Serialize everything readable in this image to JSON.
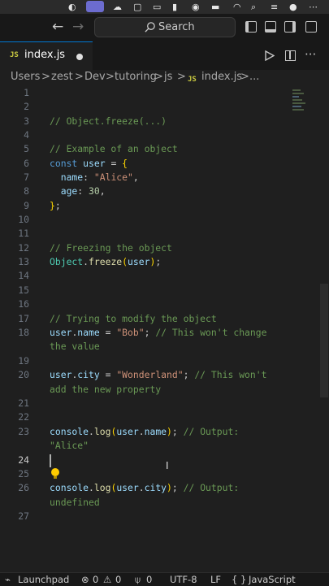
{
  "titlebar": {
    "search_label": "Search"
  },
  "tab": {
    "badge": "JS",
    "filename": "index.js"
  },
  "breadcrumb": {
    "items": [
      "Users",
      "zest",
      "Dev",
      "tutoring",
      "js",
      "index.js",
      "..."
    ],
    "separator": ">",
    "js_badge": "JS"
  },
  "editor": {
    "line_numbers": [
      "1",
      "2",
      "3",
      "4",
      "5",
      "6",
      "7",
      "8",
      "9",
      "10",
      "11",
      "12",
      "13",
      "14",
      "15",
      "16",
      "17",
      "18",
      "19",
      "20",
      "21",
      "22",
      "23",
      "24",
      "25",
      "26",
      "27"
    ],
    "active_line": "24",
    "code": {
      "l3": "// Object.freeze(...)",
      "l5": "// Example of an object",
      "l6_kw": "const",
      "l6_var": "user",
      "l6_op": " = ",
      "l6_br": "{",
      "l7_key": "name",
      "l7_sep": ": ",
      "l7_val": "\"Alice\"",
      "l7_end": ",",
      "l8_key": "age",
      "l8_sep": ": ",
      "l8_val": "30",
      "l8_end": ",",
      "l9_br": "}",
      "l9_end": ";",
      "l12": "// Freezing the object",
      "l13_obj": "Object",
      "l13_fn": "freeze",
      "l13_arg": "user",
      "l17": "// Trying to modify the object",
      "l18_var": "user",
      "l18_prop": "name",
      "l18_op": " = ",
      "l18_str": "\"Bob\"",
      "l18_semi": "; ",
      "l18_com": "// This won't change",
      "l18_com2": "the value",
      "l20_var": "user",
      "l20_prop": "city",
      "l20_op": " = ",
      "l20_str": "\"Wonderland\"",
      "l20_semi": "; ",
      "l20_com": "// This won't",
      "l20_com2": "add the new property",
      "l23_obj": "console",
      "l23_fn": "log",
      "l23_var": "user",
      "l23_prop": "name",
      "l23_com": "// Output:",
      "l23_com2": "\"Alice\"",
      "l26_obj": "console",
      "l26_fn": "log",
      "l26_var": "user",
      "l26_prop": "city",
      "l26_com": "// Output:",
      "l26_com2": "undefined"
    }
  },
  "statusbar": {
    "launchpad": "Launchpad",
    "errors": "0",
    "warnings": "0",
    "ports": "0",
    "encoding": "UTF-8",
    "eol": "LF",
    "language_braces": "{ }",
    "language": "JavaScript"
  },
  "colors": {
    "accent": "#0078d4",
    "comment": "#6a9955",
    "keyword": "#569cd6",
    "variable": "#9cdcfe",
    "function": "#dcdcaa",
    "string": "#ce9178",
    "number": "#b5cea8",
    "class": "#4ec9b0",
    "bracket": "#ffd700"
  }
}
